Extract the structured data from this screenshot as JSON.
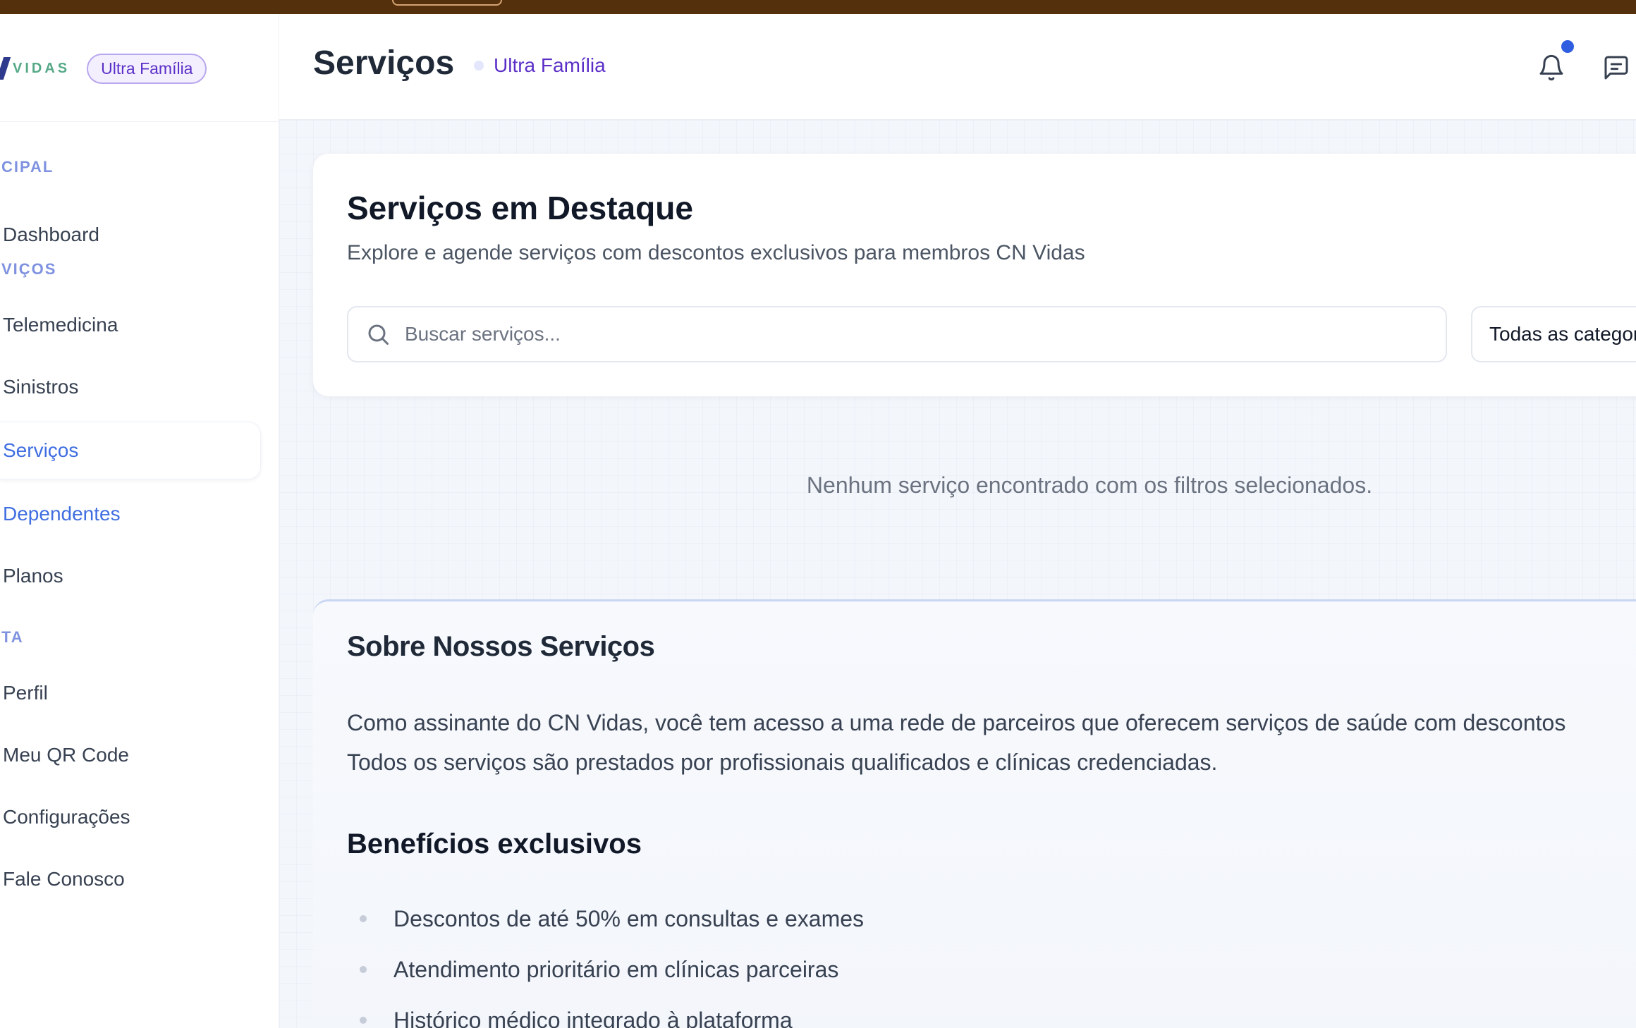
{
  "sidebar": {
    "brand": {
      "text": "VIDAS",
      "plan_badge": "Ultra Família"
    },
    "sections": {
      "principal": "CIPAL",
      "servicos": "VIÇOS",
      "conta": "TA"
    },
    "items": [
      {
        "label": "Dashboard"
      },
      {
        "label": "Telemedicina"
      },
      {
        "label": "Sinistros"
      },
      {
        "label": "Serviços"
      },
      {
        "label": "Dependentes"
      },
      {
        "label": "Planos"
      },
      {
        "label": "Perfil"
      },
      {
        "label": "Meu QR Code"
      },
      {
        "label": "Configurações"
      },
      {
        "label": "Fale Conosco"
      }
    ],
    "active_item": "Serviços"
  },
  "header": {
    "title": "Serviços",
    "plan": "Ultra Família",
    "icons": [
      "bell-icon",
      "chat-icon"
    ],
    "notification_dot_color": "#2f5fe0"
  },
  "featured": {
    "title": "Serviços em Destaque",
    "subtitle": "Explore e agende serviços com descontos exclusivos para membros CN Vidas",
    "search_placeholder": "Buscar serviços...",
    "category_selected": "Todas as categorias"
  },
  "empty_message": "Nenhum serviço encontrado com os filtros selecionados.",
  "about": {
    "title": "Sobre Nossos Serviços",
    "text_line1": "Como assinante do CN Vidas, você tem acesso a uma rede de parceiros que oferecem serviços de saúde com descontos",
    "text_line2": "Todos os serviços são prestados por profissionais qualificados e clínicas credenciadas.",
    "benefits_title": "Benefícios exclusivos",
    "benefits": [
      "Descontos de até 50% em consultas e exames",
      "Atendimento prioritário em clínicas parceiras",
      "Histórico médico integrado à plataforma"
    ]
  },
  "colors": {
    "accent": "#3f6ee0",
    "plan_purple": "#5b2fc7",
    "topbar": "#55300c",
    "brand_green": "#55a987"
  }
}
